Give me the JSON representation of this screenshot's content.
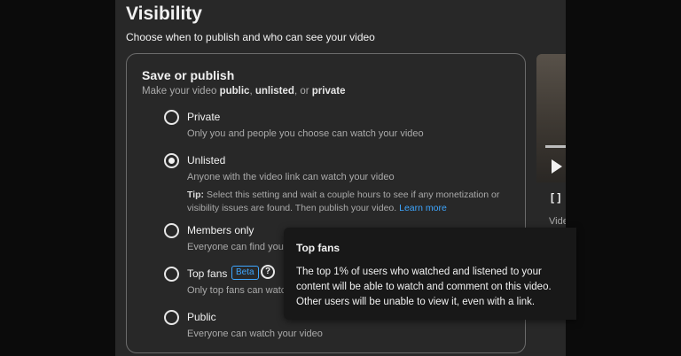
{
  "colors": {
    "background": "#282828",
    "accent": "#3ea6ff",
    "border": "#6b6b6b",
    "tooltip": "#181818"
  },
  "header": {
    "title": "Visibility",
    "subtitle": "Choose when to publish and who can see your video"
  },
  "card": {
    "title": "Save or publish",
    "desc_prefix": "Make your video ",
    "desc_public": "public",
    "desc_sep1": ", ",
    "desc_unlisted": "unlisted",
    "desc_sep2": ", or ",
    "desc_private": "private"
  },
  "options": [
    {
      "label": "Private",
      "desc": "Only you and people you choose can watch your video",
      "selected": false
    },
    {
      "label": "Unlisted",
      "desc": "Anyone with the video link can watch your video",
      "selected": true,
      "tip_label": "Tip:",
      "tip_text": " Select this setting and wait a couple hours to see if any monetization or visibility issues are found. Then publish your video. ",
      "tip_link": "Learn more"
    },
    {
      "label": "Members only",
      "desc": "Everyone can find your",
      "selected": false
    },
    {
      "label": "Top fans",
      "badge": "Beta",
      "help_icon": "?",
      "desc": "Only top fans can watc",
      "selected": false
    },
    {
      "label": "Public",
      "desc": "Everyone can watch your video",
      "selected": false
    }
  ],
  "preview": {
    "partial_label": "Vide",
    "icon": "fullscreen-icon",
    "glyph": "[ ]"
  },
  "tooltip": {
    "title": "Top fans",
    "body": "The top 1% of users who watched and listened to your content will be able to watch and comment on this video. Other users will be unable to view it, even with a link."
  }
}
